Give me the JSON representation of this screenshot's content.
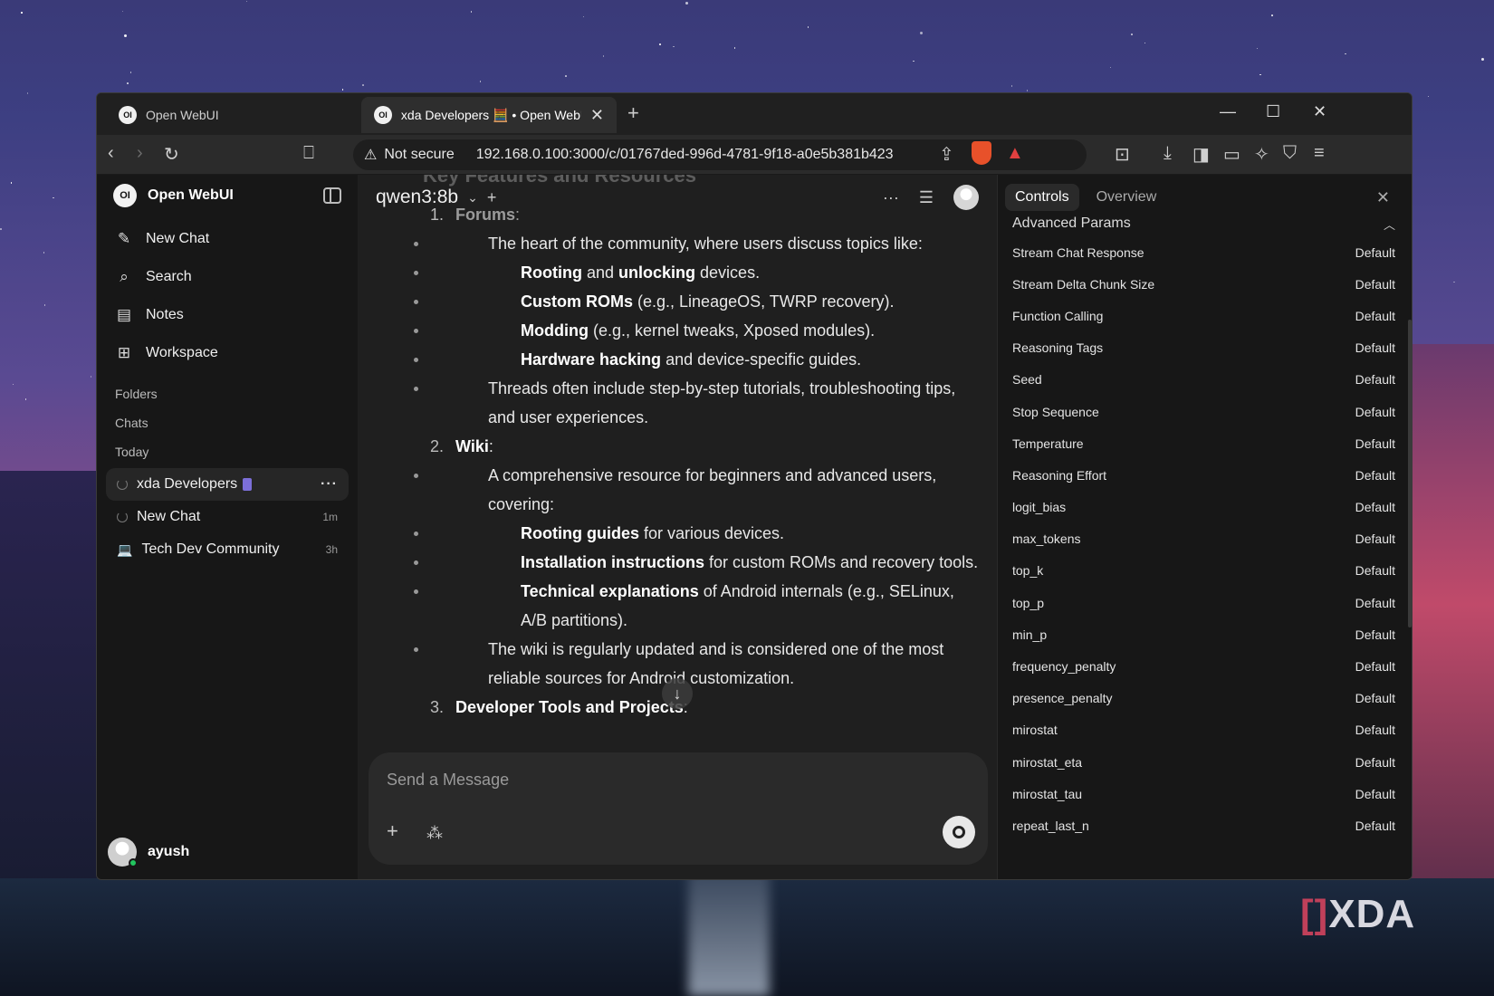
{
  "browser": {
    "tabs": [
      {
        "label": "Open WebUI"
      },
      {
        "label": "xda Developers 🧮 • Open WebUI"
      }
    ],
    "security_label": "Not secure",
    "url": "192.168.0.100:3000/c/01767ded-996d-4781-9f18-a0e5b381b423"
  },
  "sidebar": {
    "app_name": "Open WebUI",
    "menu": [
      {
        "label": "New Chat",
        "icon": "edit-icon"
      },
      {
        "label": "Search",
        "icon": "search-icon"
      },
      {
        "label": "Notes",
        "icon": "notes-icon"
      },
      {
        "label": "Workspace",
        "icon": "workspace-icon"
      }
    ],
    "folders_label": "Folders",
    "chats_label": "Chats",
    "today_label": "Today",
    "chats": [
      {
        "title": "xda Developers",
        "time": ""
      },
      {
        "title": "New Chat",
        "time": "1m"
      },
      {
        "title": "Tech Dev Community",
        "time": "3h"
      }
    ],
    "user_name": "ayush"
  },
  "main": {
    "model": "qwen3:8b",
    "ghost_heading": "Key Features and Resources",
    "items": {
      "n1": "1.",
      "h1": "Forums",
      "b1": "The heart of the community, where users discuss topics like:",
      "s1a_b": "Rooting",
      "s1a_m": " and ",
      "s1a_b2": "unlocking",
      "s1a_t": " devices.",
      "s1b_b": "Custom ROMs",
      "s1b_t": " (e.g., LineageOS, TWRP recovery).",
      "s1c_b": "Modding",
      "s1c_t": " (e.g., kernel tweaks, Xposed modules).",
      "s1d_b": "Hardware hacking",
      "s1d_t": " and device-specific guides.",
      "b2": "Threads often include step-by-step tutorials, troubleshooting tips, and user experiences.",
      "n2": "2.",
      "h2": "Wiki",
      "b3": "A comprehensive resource for beginners and advanced users, covering:",
      "s3a_b": "Rooting guides",
      "s3a_t": " for various devices.",
      "s3b_b": "Installation instructions",
      "s3b_t": " for custom ROMs and recovery tools.",
      "s3c_b": "Technical explanations",
      "s3c_t": " of Android internals (e.g., SELinux, A/B partitions).",
      "b4": "The wiki is regularly updated and is considered one of the most reliable sources for Android customization.",
      "n3": "3.",
      "h3": "Developer Tools and Projects"
    },
    "composer_placeholder": "Send a Message"
  },
  "panel": {
    "tabs": [
      "Controls",
      "Overview"
    ],
    "section": "Advanced Params",
    "params": [
      {
        "name": "Stream Chat Response",
        "value": "Default"
      },
      {
        "name": "Stream Delta Chunk Size",
        "value": "Default"
      },
      {
        "name": "Function Calling",
        "value": "Default"
      },
      {
        "name": "Reasoning Tags",
        "value": "Default"
      },
      {
        "name": "Seed",
        "value": "Default"
      },
      {
        "name": "Stop Sequence",
        "value": "Default"
      },
      {
        "name": "Temperature",
        "value": "Default"
      },
      {
        "name": "Reasoning Effort",
        "value": "Default"
      },
      {
        "name": "logit_bias",
        "value": "Default"
      },
      {
        "name": "max_tokens",
        "value": "Default"
      },
      {
        "name": "top_k",
        "value": "Default"
      },
      {
        "name": "top_p",
        "value": "Default"
      },
      {
        "name": "min_p",
        "value": "Default"
      },
      {
        "name": "frequency_penalty",
        "value": "Default"
      },
      {
        "name": "presence_penalty",
        "value": "Default"
      },
      {
        "name": "mirostat",
        "value": "Default"
      },
      {
        "name": "mirostat_eta",
        "value": "Default"
      },
      {
        "name": "mirostat_tau",
        "value": "Default"
      },
      {
        "name": "repeat_last_n",
        "value": "Default"
      }
    ]
  },
  "watermark": "XDA"
}
